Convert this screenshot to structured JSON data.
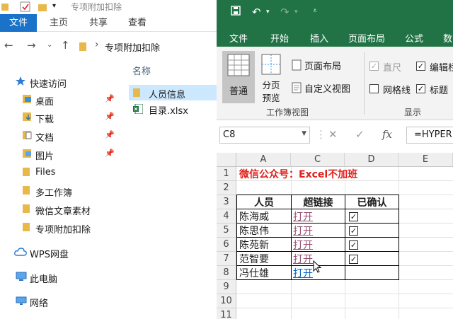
{
  "explorer": {
    "window_title": "专项附加扣除",
    "ribbon_tabs": {
      "file": "文件",
      "home": "主页",
      "share": "共享",
      "view": "查看"
    },
    "address": "专项附加扣除",
    "nav": {
      "quick_access": "快速访问",
      "desktop": "桌面",
      "downloads": "下载",
      "documents": "文档",
      "pictures": "图片",
      "files": "Files",
      "workbooks": "多工作簿",
      "wechat_materials": "微信文章素材",
      "special_deduction": "专项附加扣除",
      "wps_drive": "WPS网盘",
      "this_pc": "此电脑",
      "network": "网络"
    },
    "column_name": "名称",
    "files": [
      "人员信息",
      "目录.xlsx"
    ]
  },
  "excel": {
    "tabs": {
      "file": "文件",
      "start": "开始",
      "insert": "插入",
      "page_layout": "页面布局",
      "formulas": "公式",
      "data": "数"
    },
    "ribbon": {
      "normal": "普通",
      "page_break": [
        "分页",
        "预览"
      ],
      "page_layout_view": "页面布局",
      "custom_views": "自定义视图",
      "group_views": "工作簿视图",
      "ruler": "直尺",
      "formula_bar": "编辑栏",
      "gridlines": "网格线",
      "headings": "标题",
      "group_show": "显示"
    },
    "name_box": "C8",
    "formula": "=HYPERLINK(",
    "columns": [
      "A",
      "C",
      "D",
      "E"
    ],
    "rows": [
      "1",
      "2",
      "3",
      "4",
      "5",
      "6",
      "7",
      "8",
      "9",
      "10",
      "11"
    ],
    "title": "微信公众号：Excel不加班",
    "headers": {
      "person": "人员",
      "link": "超链接",
      "confirmed": "已确认"
    },
    "table": [
      {
        "name": "陈海威",
        "link": "打开",
        "visited": true,
        "confirmed": true
      },
      {
        "name": "陈思伟",
        "link": "打开",
        "visited": true,
        "confirmed": true
      },
      {
        "name": "陈苑新",
        "link": "打开",
        "visited": true,
        "confirmed": true
      },
      {
        "name": "范智要",
        "link": "打开",
        "visited": true,
        "confirmed": true
      },
      {
        "name": "冯仕雄",
        "link": "打开",
        "visited": false,
        "confirmed": false
      }
    ]
  }
}
